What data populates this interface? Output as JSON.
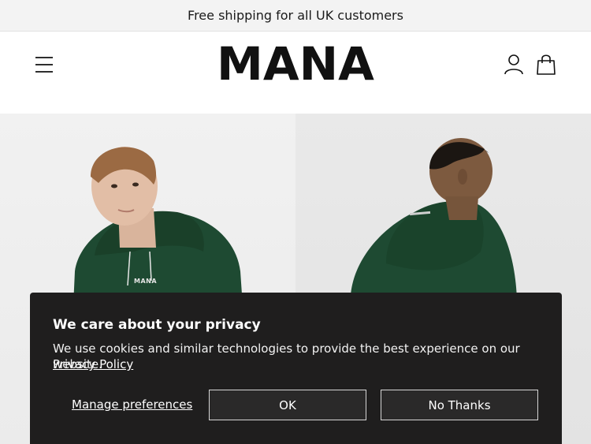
{
  "announcement": {
    "text": "Free shipping for all UK customers"
  },
  "header": {
    "logo": "MANA",
    "icons": {
      "menu": "menu-icon",
      "account": "user-icon",
      "cart": "shopping-bag-icon"
    }
  },
  "hero": {
    "left_image": "model-green-hoodie-front",
    "right_image": "model-green-hoodie-back",
    "hoodie_print": "MANA",
    "colors": {
      "hoodie": "#1e4a32"
    }
  },
  "cookie_banner": {
    "title": "We care about your privacy",
    "text": "We use cookies and similar technologies to provide the best experience on our website.",
    "privacy_link": "Privacy Policy",
    "manage_label": "Manage preferences",
    "ok_label": "OK",
    "no_thanks_label": "No Thanks",
    "colors": {
      "background": "#1f1e1e",
      "button": "#2a2929",
      "border": "#d6d6d6"
    }
  }
}
